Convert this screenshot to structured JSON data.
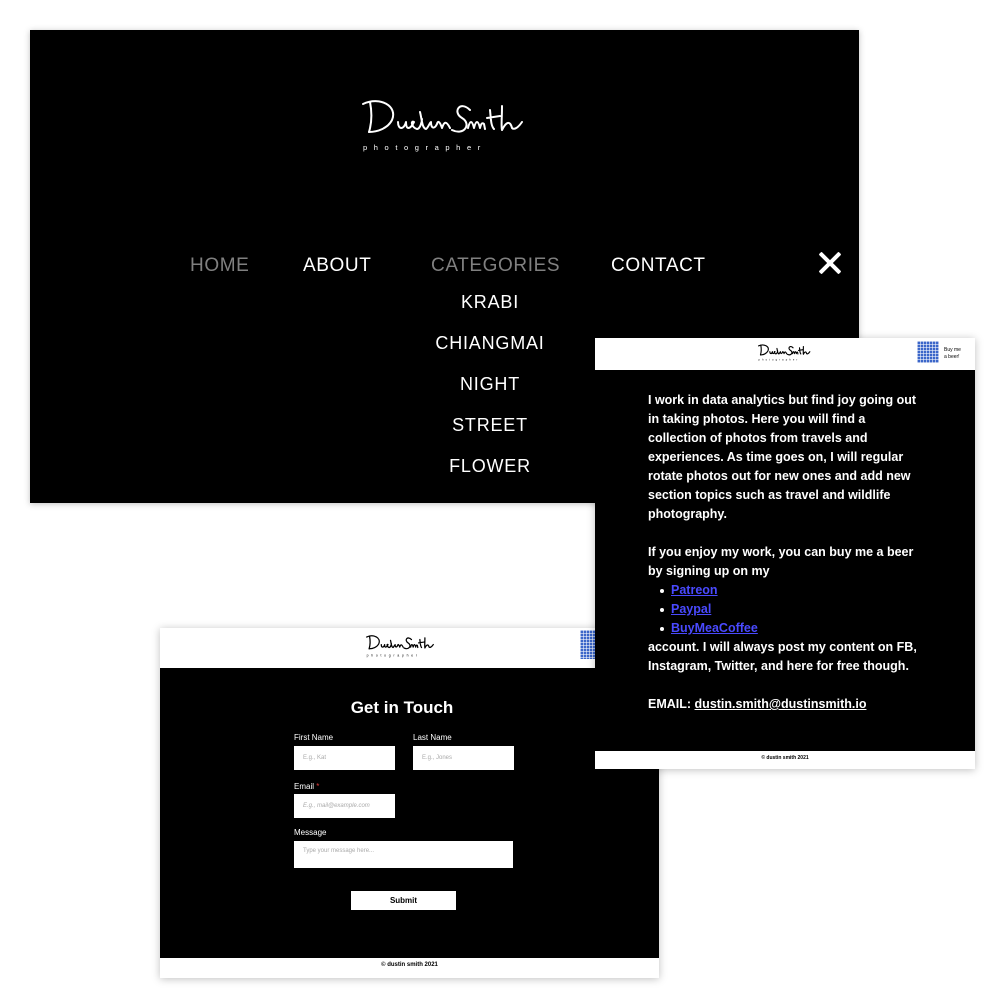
{
  "brand": {
    "signature_image": "Dustin Smith handwritten signature",
    "tagline": "photographer"
  },
  "nav": {
    "items": [
      {
        "label": "HOME",
        "dimmed": true
      },
      {
        "label": "ABOUT",
        "dimmed": false
      },
      {
        "label": "CATEGORIES",
        "dimmed": true
      },
      {
        "label": "CONTACT",
        "dimmed": false
      }
    ],
    "close_icon": "close-icon",
    "categories": [
      "KRABI",
      "CHIANGMAI",
      "NIGHT",
      "STREET",
      "FLOWER"
    ]
  },
  "contact": {
    "title": "Get in Touch",
    "first_name_label": "First Name",
    "first_name_placeholder": "E.g., Kat",
    "last_name_label": "Last Name",
    "last_name_placeholder": "E.g., Jones",
    "email_label": "Email",
    "email_required_mark": "*",
    "email_placeholder": "E.g., mail@example.com",
    "message_label": "Message",
    "message_placeholder": "Type your message here...",
    "submit_label": "Submit",
    "footer": "© dustin smith 2021",
    "qr_icon": "qr-code-icon"
  },
  "about": {
    "beer_label_line1": "Buy me",
    "beer_label_line2": "a beer!",
    "paragraph1": "I work in data analytics but find joy going out in taking photos. Here you will find a collection of photos from travels and experiences. As time goes on, I will regular rotate photos out for new ones and add new section topics such as travel and wildlife photography.",
    "paragraph2": "If you enjoy my work, you can buy me a beer by signing up on my",
    "links": [
      "Patreon",
      "Paypal",
      "BuyMeaCoffee"
    ],
    "paragraph3": "account. I will always post my content on FB, Instagram, Twitter, and here for free though.",
    "email_prefix": "EMAIL:",
    "email": "dustin.smith@dustinsmith.io",
    "footer": "© dustin smith 2021",
    "qr_icon": "qr-code-icon"
  },
  "colors": {
    "background": "#000000",
    "text": "#ffffff",
    "nav_dimmed": "#808080",
    "link": "#4a4aff",
    "qr": "#3b66c9",
    "required": "#e03b3b"
  }
}
